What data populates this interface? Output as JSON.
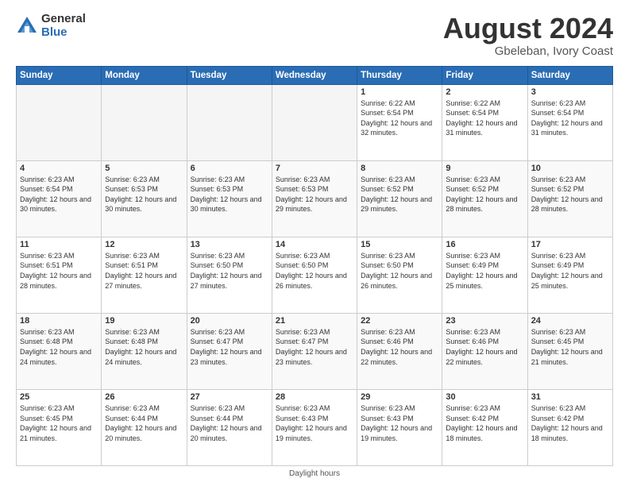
{
  "logo": {
    "general": "General",
    "blue": "Blue"
  },
  "title": {
    "month_year": "August 2024",
    "location": "Gbeleban, Ivory Coast"
  },
  "days_of_week": [
    "Sunday",
    "Monday",
    "Tuesday",
    "Wednesday",
    "Thursday",
    "Friday",
    "Saturday"
  ],
  "footer": {
    "note": "Daylight hours"
  },
  "weeks": [
    [
      {
        "day": "",
        "info": ""
      },
      {
        "day": "",
        "info": ""
      },
      {
        "day": "",
        "info": ""
      },
      {
        "day": "",
        "info": ""
      },
      {
        "day": "1",
        "info": "Sunrise: 6:22 AM\nSunset: 6:54 PM\nDaylight: 12 hours\nand 32 minutes."
      },
      {
        "day": "2",
        "info": "Sunrise: 6:22 AM\nSunset: 6:54 PM\nDaylight: 12 hours\nand 31 minutes."
      },
      {
        "day": "3",
        "info": "Sunrise: 6:23 AM\nSunset: 6:54 PM\nDaylight: 12 hours\nand 31 minutes."
      }
    ],
    [
      {
        "day": "4",
        "info": "Sunrise: 6:23 AM\nSunset: 6:54 PM\nDaylight: 12 hours\nand 30 minutes."
      },
      {
        "day": "5",
        "info": "Sunrise: 6:23 AM\nSunset: 6:53 PM\nDaylight: 12 hours\nand 30 minutes."
      },
      {
        "day": "6",
        "info": "Sunrise: 6:23 AM\nSunset: 6:53 PM\nDaylight: 12 hours\nand 30 minutes."
      },
      {
        "day": "7",
        "info": "Sunrise: 6:23 AM\nSunset: 6:53 PM\nDaylight: 12 hours\nand 29 minutes."
      },
      {
        "day": "8",
        "info": "Sunrise: 6:23 AM\nSunset: 6:52 PM\nDaylight: 12 hours\nand 29 minutes."
      },
      {
        "day": "9",
        "info": "Sunrise: 6:23 AM\nSunset: 6:52 PM\nDaylight: 12 hours\nand 28 minutes."
      },
      {
        "day": "10",
        "info": "Sunrise: 6:23 AM\nSunset: 6:52 PM\nDaylight: 12 hours\nand 28 minutes."
      }
    ],
    [
      {
        "day": "11",
        "info": "Sunrise: 6:23 AM\nSunset: 6:51 PM\nDaylight: 12 hours\nand 28 minutes."
      },
      {
        "day": "12",
        "info": "Sunrise: 6:23 AM\nSunset: 6:51 PM\nDaylight: 12 hours\nand 27 minutes."
      },
      {
        "day": "13",
        "info": "Sunrise: 6:23 AM\nSunset: 6:50 PM\nDaylight: 12 hours\nand 27 minutes."
      },
      {
        "day": "14",
        "info": "Sunrise: 6:23 AM\nSunset: 6:50 PM\nDaylight: 12 hours\nand 26 minutes."
      },
      {
        "day": "15",
        "info": "Sunrise: 6:23 AM\nSunset: 6:50 PM\nDaylight: 12 hours\nand 26 minutes."
      },
      {
        "day": "16",
        "info": "Sunrise: 6:23 AM\nSunset: 6:49 PM\nDaylight: 12 hours\nand 25 minutes."
      },
      {
        "day": "17",
        "info": "Sunrise: 6:23 AM\nSunset: 6:49 PM\nDaylight: 12 hours\nand 25 minutes."
      }
    ],
    [
      {
        "day": "18",
        "info": "Sunrise: 6:23 AM\nSunset: 6:48 PM\nDaylight: 12 hours\nand 24 minutes."
      },
      {
        "day": "19",
        "info": "Sunrise: 6:23 AM\nSunset: 6:48 PM\nDaylight: 12 hours\nand 24 minutes."
      },
      {
        "day": "20",
        "info": "Sunrise: 6:23 AM\nSunset: 6:47 PM\nDaylight: 12 hours\nand 23 minutes."
      },
      {
        "day": "21",
        "info": "Sunrise: 6:23 AM\nSunset: 6:47 PM\nDaylight: 12 hours\nand 23 minutes."
      },
      {
        "day": "22",
        "info": "Sunrise: 6:23 AM\nSunset: 6:46 PM\nDaylight: 12 hours\nand 22 minutes."
      },
      {
        "day": "23",
        "info": "Sunrise: 6:23 AM\nSunset: 6:46 PM\nDaylight: 12 hours\nand 22 minutes."
      },
      {
        "day": "24",
        "info": "Sunrise: 6:23 AM\nSunset: 6:45 PM\nDaylight: 12 hours\nand 21 minutes."
      }
    ],
    [
      {
        "day": "25",
        "info": "Sunrise: 6:23 AM\nSunset: 6:45 PM\nDaylight: 12 hours\nand 21 minutes."
      },
      {
        "day": "26",
        "info": "Sunrise: 6:23 AM\nSunset: 6:44 PM\nDaylight: 12 hours\nand 20 minutes."
      },
      {
        "day": "27",
        "info": "Sunrise: 6:23 AM\nSunset: 6:44 PM\nDaylight: 12 hours\nand 20 minutes."
      },
      {
        "day": "28",
        "info": "Sunrise: 6:23 AM\nSunset: 6:43 PM\nDaylight: 12 hours\nand 19 minutes."
      },
      {
        "day": "29",
        "info": "Sunrise: 6:23 AM\nSunset: 6:43 PM\nDaylight: 12 hours\nand 19 minutes."
      },
      {
        "day": "30",
        "info": "Sunrise: 6:23 AM\nSunset: 6:42 PM\nDaylight: 12 hours\nand 18 minutes."
      },
      {
        "day": "31",
        "info": "Sunrise: 6:23 AM\nSunset: 6:42 PM\nDaylight: 12 hours\nand 18 minutes."
      }
    ]
  ]
}
